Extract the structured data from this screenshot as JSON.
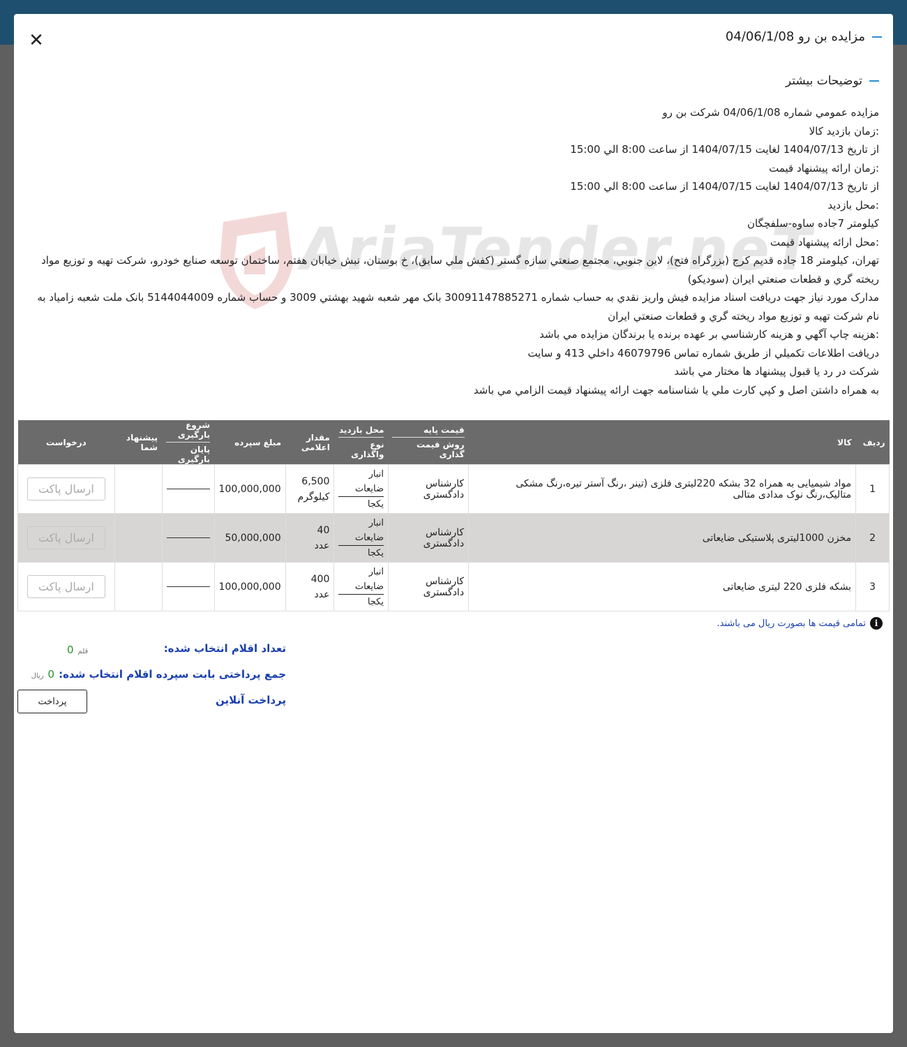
{
  "header": {
    "title": "مزايده بن رو 04/06/1/08"
  },
  "section": {
    "title": "توضیحات بیشتر"
  },
  "description": [
    "مزايده عمومي شماره 04/06/1/08 شرکت بن رو",
    ":زمان بازديد کالا",
    "از تاريخ 1404/07/13 لغايت 1404/07/15 از ساعت 8:00 الي 15:00",
    ":زمان ارائه پيشنهاد قيمت",
    "از تاريخ 1404/07/13 لغايت 1404/07/15 از ساعت 8:00 الي 15:00",
    ":محل بازديد",
    "کيلومتر 7جاده ساوه-سلفچگان",
    ":محل ارائه پيشنهاد قيمت",
    "تهران، کيلومتر 18 جاده قديم کرج (بزرگراه فتح)، لاين جنوبي، مجتمع صنعتي سازه گستر (کفش ملي سابق)، خ بوستان، نبش خيابان هفتم، ساختمان توسعه صنايع خودرو، شرکت تهيه و توزيع مواد ريخته گري و قطعات صنعتي ايران (سوديکو)",
    "مدارک مورد نياز جهت دريافت اسناد مزايده فيش واريز نقدي به حساب شماره 30091147885271 بانک مهر شعبه شهيد بهشتي 3009 و حساب شماره 5144044009 بانک ملت شعبه زامياد به نام شرکت تهيه و توزيع مواد ريخته گري و قطعات صنعتي ايران",
    ":هزينه چاپ آگهي و هزينه کارشناسي بر عهده برنده يا برندگان مزايده مي باشد",
    "دريافت اطلاعات تکميلي از طريق شماره تماس 46079796 داخلي 413 و سايت",
    "شرکت در رد يا قبول پيشنهاد ها مختار مي باشد",
    "به همراه داشتن اصل و کپي کارت ملي يا شناسنامه جهت ارائه پيشنهاد قيمت الزامي مي باشد"
  ],
  "watermark": {
    "text": "AriaTender.neT"
  },
  "table": {
    "headers": {
      "row": "ردیف",
      "item": "کالا",
      "base_price": "قیمت پایه",
      "pricing_method": "روش قیمت گذاری",
      "visit_place": "محل بازدید",
      "assign_type": "نوع واگذاری",
      "quantity": "مقدار اعلامی",
      "deposit": "مبلغ سپرده",
      "load_start": "شروع بارگیری",
      "load_end": "پایان بارگیری",
      "your_offer": "پیشنهاد شما",
      "request": "درخواست"
    },
    "rows": [
      {
        "num": "1",
        "item": "مواد شیمیایی به همراه 32 بشکه 220لیتری فلزی (تینر ،رنگ آستر تیره،رنگ مشکی متالیک،رنگ نوک مدادی متالی",
        "pricing": "کارشناس دادگستری",
        "visit": "انبار ضایعات",
        "assign": "یکجا",
        "qty": "6,500",
        "unit": "کیلوگرم",
        "deposit": "100,000,000",
        "button": "ارسال پاکت"
      },
      {
        "num": "2",
        "item": "مخزن 1000لیتری پلاستیکی ضایعاتی",
        "pricing": "کارشناس دادگستری",
        "visit": "انبار ضایعات",
        "assign": "یکجا",
        "qty": "40",
        "unit": "عدد",
        "deposit": "50,000,000",
        "button": "ارسال پاکت"
      },
      {
        "num": "3",
        "item": "بشکه فلزی 220 لیتری ضایعاتی",
        "pricing": "کارشناس دادگستری",
        "visit": "انبار ضایعات",
        "assign": "یکجا",
        "qty": "400",
        "unit": "عدد",
        "deposit": "100,000,000",
        "button": "ارسال پاکت"
      }
    ]
  },
  "note": {
    "text": "تمامی قیمت ها بصورت ریال می باشند."
  },
  "summary": {
    "selected_label": "تعداد اقلام انتخاب شده:",
    "selected_value": "0",
    "selected_unit": "قلم",
    "deposit_label": "جمع پرداختی بابت سپرده اقلام انتخاب شده:",
    "deposit_value": "0",
    "deposit_unit": "ریال",
    "online_label": "پرداخت آنلاین",
    "pay_button": "پرداخت"
  },
  "colors": {
    "accent": "#2b8fd6",
    "link_blue": "#1a3fae",
    "value_green": "#2a8f2a",
    "table_header": "#6b6b6b",
    "row_alt": "#d8d5d5"
  }
}
